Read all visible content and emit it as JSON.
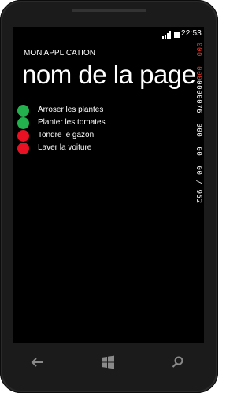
{
  "status_bar": {
    "time": "22:53",
    "icons": [
      "signal-icon",
      "battery-icon"
    ]
  },
  "app": {
    "title": "MON APPLICATION",
    "page_title": "nom de la page"
  },
  "tasks": [
    {
      "label": "Arroser les plantes",
      "status": "done",
      "color": "#22b14c"
    },
    {
      "label": "Planter les tomates",
      "status": "done",
      "color": "#22b14c"
    },
    {
      "label": "Tondre le gazon",
      "status": "todo",
      "color": "#e81123"
    },
    {
      "label": "Laver la voiture",
      "status": "todo",
      "color": "#e81123"
    }
  ],
  "frame_counters": {
    "red_part": "000  000",
    "white_part": "0000076  000  00  00 / 952"
  },
  "nav": {
    "icons": [
      "back-arrow-icon",
      "windows-start-icon",
      "search-icon"
    ]
  },
  "colors": {
    "background": "#000000",
    "foreground": "#ffffff",
    "done": "#22b14c",
    "todo": "#e81123",
    "counter_red": "#e8392b"
  }
}
